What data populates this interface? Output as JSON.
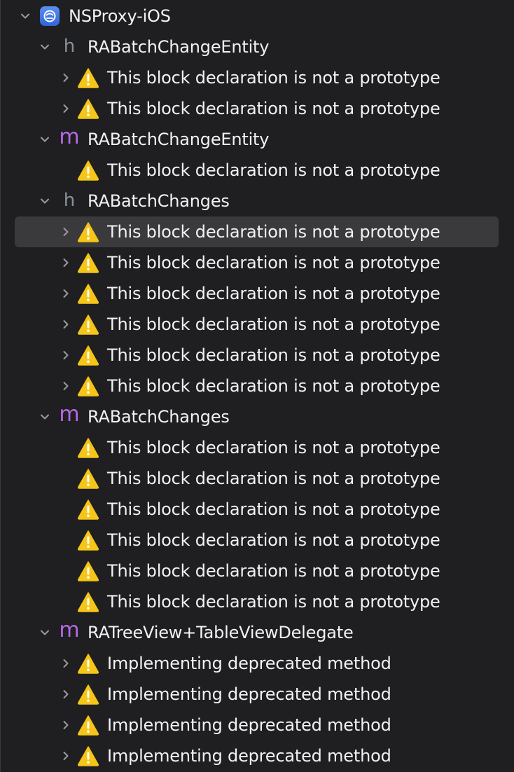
{
  "project": {
    "name": "NSProxy-iOS",
    "icon": "xcode-project-icon",
    "expanded": true
  },
  "colors": {
    "background": "#1f1f21",
    "selection": "#3a3a3d",
    "text": "#f2f2f2",
    "header_icon": "#8a9099",
    "implementation_icon": "#b569e6",
    "warning": "#f5c518"
  },
  "groups": [
    {
      "file_type": "h",
      "file_name": "RABatchChangeEntity",
      "expanded": true,
      "issues": [
        {
          "text": "This block declaration is not a prototype",
          "expandable": true,
          "selected": false
        },
        {
          "text": "This block declaration is not a prototype",
          "expandable": true,
          "selected": false
        }
      ]
    },
    {
      "file_type": "m",
      "file_name": "RABatchChangeEntity",
      "expanded": true,
      "issues": [
        {
          "text": "This block declaration is not a prototype",
          "expandable": false,
          "selected": false
        }
      ]
    },
    {
      "file_type": "h",
      "file_name": "RABatchChanges",
      "expanded": true,
      "issues": [
        {
          "text": "This block declaration is not a prototype",
          "expandable": true,
          "selected": true
        },
        {
          "text": "This block declaration is not a prototype",
          "expandable": true,
          "selected": false
        },
        {
          "text": "This block declaration is not a prototype",
          "expandable": true,
          "selected": false
        },
        {
          "text": "This block declaration is not a prototype",
          "expandable": true,
          "selected": false
        },
        {
          "text": "This block declaration is not a prototype",
          "expandable": true,
          "selected": false
        },
        {
          "text": "This block declaration is not a prototype",
          "expandable": true,
          "selected": false
        }
      ]
    },
    {
      "file_type": "m",
      "file_name": "RABatchChanges",
      "expanded": true,
      "issues": [
        {
          "text": "This block declaration is not a prototype",
          "expandable": false,
          "selected": false
        },
        {
          "text": "This block declaration is not a prototype",
          "expandable": false,
          "selected": false
        },
        {
          "text": "This block declaration is not a prototype",
          "expandable": false,
          "selected": false
        },
        {
          "text": "This block declaration is not a prototype",
          "expandable": false,
          "selected": false
        },
        {
          "text": "This block declaration is not a prototype",
          "expandable": false,
          "selected": false
        },
        {
          "text": "This block declaration is not a prototype",
          "expandable": false,
          "selected": false
        }
      ]
    },
    {
      "file_type": "m",
      "file_name": "RATreeView+TableViewDelegate",
      "expanded": true,
      "issues": [
        {
          "text": "Implementing deprecated method",
          "expandable": true,
          "selected": false
        },
        {
          "text": "Implementing deprecated method",
          "expandable": true,
          "selected": false
        },
        {
          "text": "Implementing deprecated method",
          "expandable": true,
          "selected": false
        },
        {
          "text": "Implementing deprecated method",
          "expandable": true,
          "selected": false
        }
      ]
    }
  ]
}
